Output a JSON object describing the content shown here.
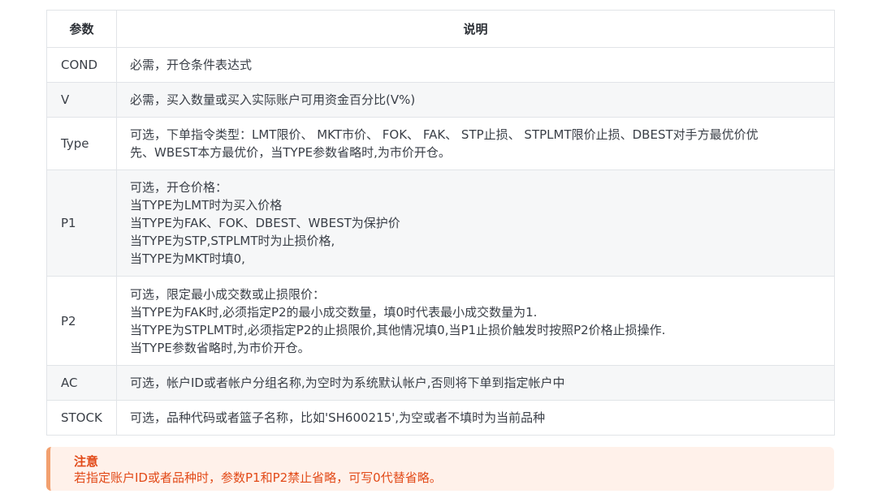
{
  "table": {
    "headers": [
      "参数",
      "说明"
    ],
    "rows": [
      {
        "param": "COND",
        "lines": [
          "必需，开仓条件表达式"
        ]
      },
      {
        "param": "V",
        "lines": [
          "必需，买入数量或买入实际账户可用资金百分比(V%)"
        ]
      },
      {
        "param": "Type",
        "lines": [
          "可选，下单指令类型：LMT限价、 MKT市价、 FOK、 FAK、 STP止损、 STPLMT限价止损、DBEST对手方最优价优",
          "先、WBEST本方最优价，当TYPE参数省略时,为市价开仓。"
        ]
      },
      {
        "param": "P1",
        "lines": [
          "可选，开仓价格：",
          "当TYPE为LMT时为买入价格",
          "当TYPE为FAK、FOK、DBEST、WBEST为保护价",
          "当TYPE为STP,STPLMT时为止损价格,",
          "当TYPE为MKT时填0,"
        ]
      },
      {
        "param": "P2",
        "lines": [
          "可选，限定最小成交数或止损限价：",
          "当TYPE为FAK时,必须指定P2的最小成交数量，填0时代表最小成交数量为1.",
          "当TYPE为STPLMT时,必须指定P2的止损限价,其他情况填0,当P1止损价触发时按照P2价格止损操作.",
          "当TYPE参数省略时,为市价开仓。"
        ]
      },
      {
        "param": "AC",
        "lines": [
          "可选，帐户ID或者帐户分组名称,为空时为系统默认帐户,否则将下单到指定帐户中"
        ]
      },
      {
        "param": "STOCK",
        "lines": [
          "可选，品种代码或者篮子名称，比如'SH600215',为空或者不填时为当前品种"
        ]
      }
    ]
  },
  "note": {
    "title": "注意",
    "text": "若指定账户ID或者品种时，参数P1和P2禁止省略，可写0代替省略。",
    "accent_color": "#f2a06f",
    "text_color": "#e24a18",
    "background": "#fff1ea"
  }
}
